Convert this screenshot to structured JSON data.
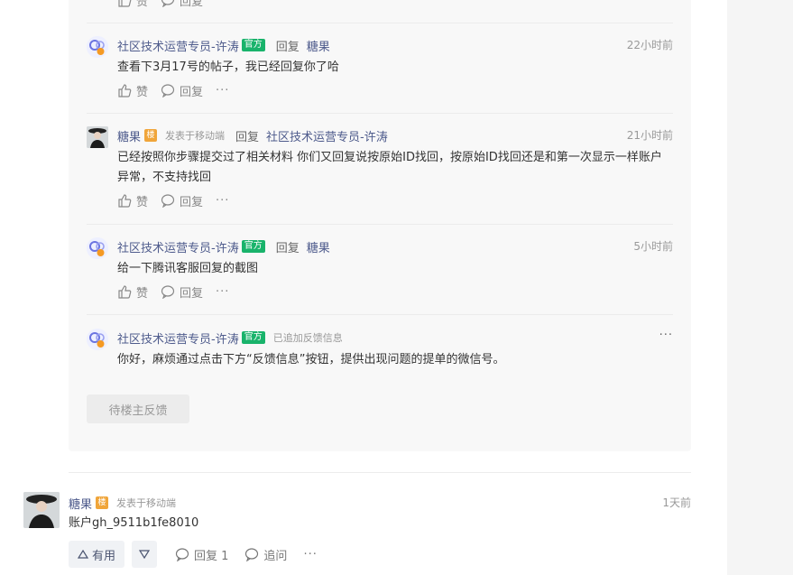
{
  "official_badge": "官方",
  "op_badge": "楼",
  "actions": {
    "like": "赞",
    "reply": "回复",
    "more": "···"
  },
  "top_partial": {
    "like": "赞",
    "reply": "回复",
    "more": "···"
  },
  "replies": [
    {
      "author": "社区技术运营专员-许涛",
      "reply_word": "回复",
      "target": "糖果",
      "time": "22小时前",
      "content": "查看下3月17号的帖子，我已经回复你了哈"
    },
    {
      "author": "糖果",
      "device": "发表于移动端",
      "reply_word": "回复",
      "target": "社区技术运营专员-许涛",
      "time": "21小时前",
      "content": "已经按照你步骤提交过了相关材料 你们又回复说按原始ID找回，按原始ID找回还是和第一次显示一样账户异常，不支持找回"
    },
    {
      "author": "社区技术运营专员-许涛",
      "reply_word": "回复",
      "target": "糖果",
      "time": "5小时前",
      "content": "给一下腾讯客服回复的截图"
    },
    {
      "author": "社区技术运营专员-许涛",
      "status": "已追加反馈信息",
      "more": "···",
      "content": "你好，麻烦通过点击下方“反馈信息”按钮，提供出现问题的提单的微信号。"
    }
  ],
  "pending_button": "待楼主反馈",
  "comment": {
    "author": "糖果",
    "device": "发表于移动端",
    "time": "1天前",
    "content": "账户gh_9511b1fe8010",
    "useful": "有用",
    "reply": "回复 1",
    "ask": "追问",
    "more": "···"
  },
  "colors": {
    "official": "#19b36b",
    "op": "#f0a53a",
    "name": "#4e5b8c",
    "panel": "#f8f8f8"
  }
}
